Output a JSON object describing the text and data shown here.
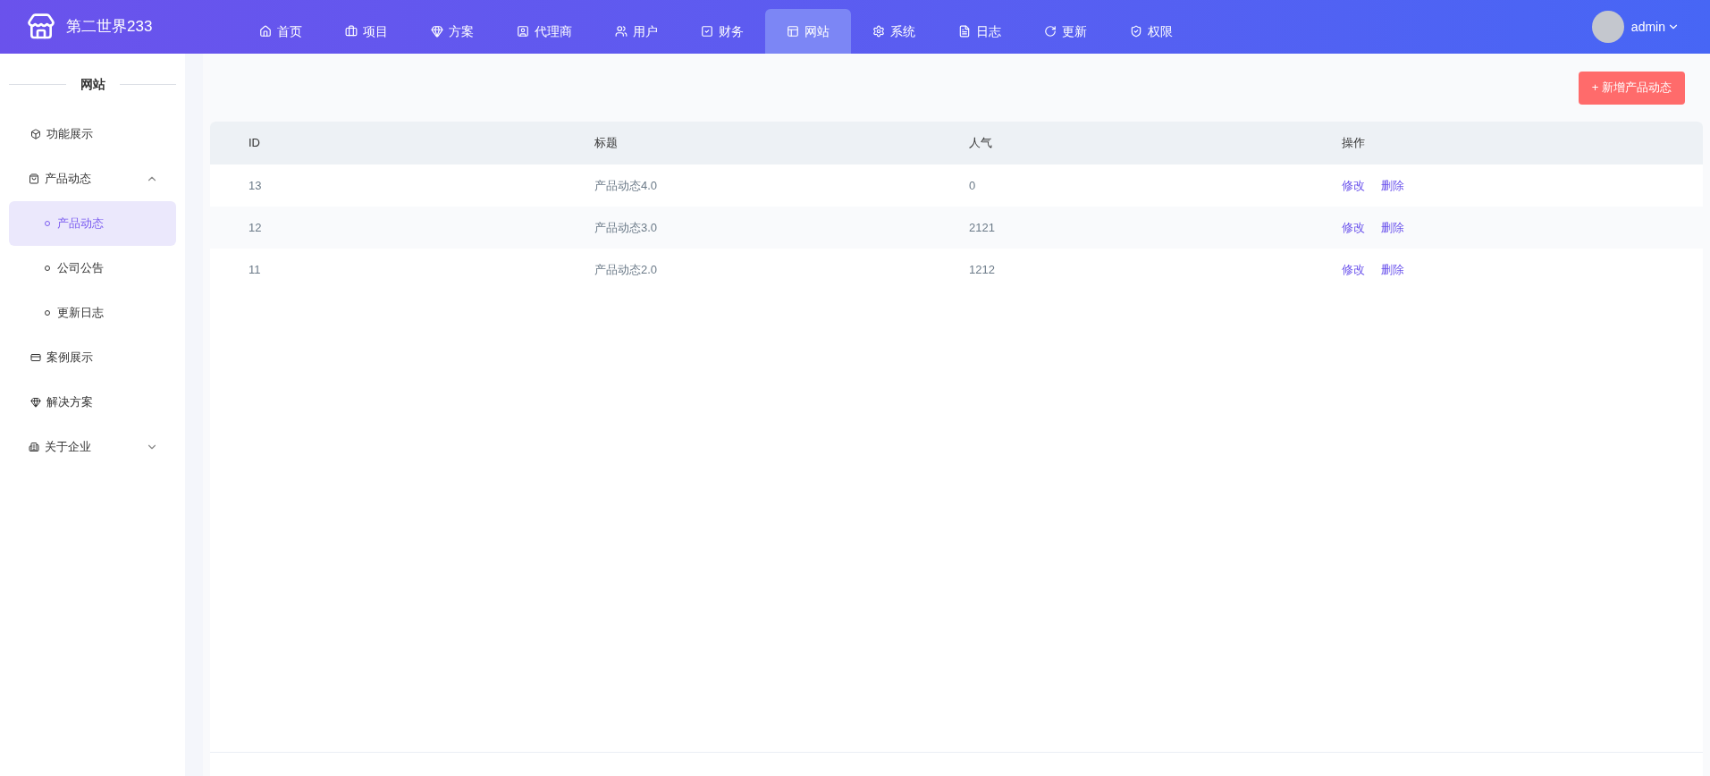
{
  "brand": {
    "name": "第二世界233"
  },
  "nav": [
    {
      "label": "首页",
      "selected": false
    },
    {
      "label": "项目",
      "selected": false
    },
    {
      "label": "方案",
      "selected": false
    },
    {
      "label": "代理商",
      "selected": false
    },
    {
      "label": "用户",
      "selected": false
    },
    {
      "label": "财务",
      "selected": false
    },
    {
      "label": "网站",
      "selected": true
    },
    {
      "label": "系统",
      "selected": false
    },
    {
      "label": "日志",
      "selected": false
    },
    {
      "label": "更新",
      "selected": false
    },
    {
      "label": "权限",
      "selected": false
    }
  ],
  "user": {
    "name": "admin"
  },
  "sidebar": {
    "title": "网站",
    "items": [
      {
        "label": "功能展示",
        "selected": false
      },
      {
        "label": "产品动态",
        "expanded": true,
        "children": [
          {
            "label": "产品动态",
            "selected": true
          },
          {
            "label": "公司公告",
            "selected": false
          },
          {
            "label": "更新日志",
            "selected": false
          }
        ]
      },
      {
        "label": "案例展示",
        "selected": false
      },
      {
        "label": "解决方案",
        "selected": false
      },
      {
        "label": "关于企业",
        "expanded": false
      }
    ]
  },
  "add_button": "+ 新增产品动态",
  "table": {
    "columns": [
      "ID",
      "标题",
      "人气",
      "操作"
    ],
    "rows": [
      {
        "id": "13",
        "title": "产品动态4.0",
        "views": "0",
        "actions": [
          "修改",
          "删除"
        ]
      },
      {
        "id": "12",
        "title": "产品动态3.0",
        "views": "2121",
        "actions": [
          "修改",
          "删除"
        ]
      },
      {
        "id": "11",
        "title": "产品动态2.0",
        "views": "1212",
        "actions": [
          "修改",
          "删除"
        ]
      }
    ]
  }
}
